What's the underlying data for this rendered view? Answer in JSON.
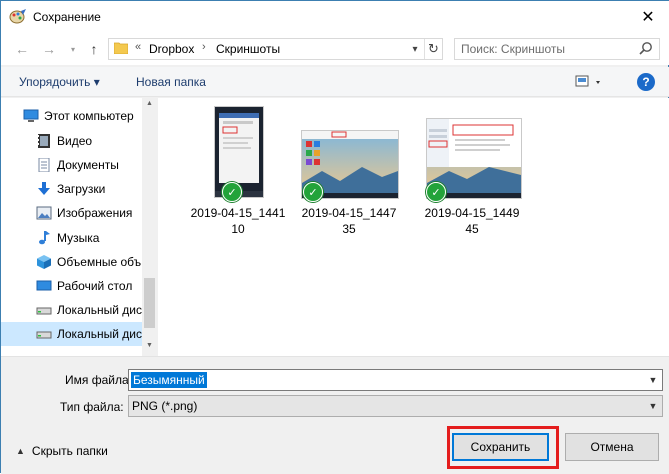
{
  "window": {
    "title": "Сохранение"
  },
  "nav": {
    "breadcrumb_sep": "«",
    "breadcrumb": [
      "Dropbox",
      "Скриншоты"
    ],
    "crumb_arrow": "›",
    "search_placeholder": "Поиск: Скриншоты"
  },
  "toolbar": {
    "organize_label": "Упорядочить ▾",
    "new_folder_label": "Новая папка",
    "help_label": "?"
  },
  "sidebar": {
    "items": [
      {
        "label": "Этот компьютер",
        "icon": "computer-icon"
      },
      {
        "label": "Видео",
        "icon": "video-icon"
      },
      {
        "label": "Документы",
        "icon": "documents-icon"
      },
      {
        "label": "Загрузки",
        "icon": "downloads-icon"
      },
      {
        "label": "Изображения",
        "icon": "pictures-icon"
      },
      {
        "label": "Музыка",
        "icon": "music-icon"
      },
      {
        "label": "Объемные объ",
        "icon": "3d-objects-icon"
      },
      {
        "label": "Рабочий стол",
        "icon": "desktop-icon"
      },
      {
        "label": "Локальный дис",
        "icon": "local-disk-icon"
      },
      {
        "label": "Локальный дис",
        "icon": "local-disk-icon",
        "selected": true
      }
    ]
  },
  "files": [
    {
      "name_line1": "2019-04-15_1441",
      "name_line2": "10"
    },
    {
      "name_line1": "2019-04-15_1447",
      "name_line2": "35"
    },
    {
      "name_line1": "2019-04-15_1449",
      "name_line2": "45"
    }
  ],
  "form": {
    "filename_label": "Имя файла:",
    "filename_value": "Безымянный",
    "filetype_label": "Тип файла:",
    "filetype_value": "PNG (*.png)"
  },
  "footer": {
    "hide_folders_label": "Скрыть папки",
    "save_label": "Сохранить",
    "cancel_label": "Отмена"
  },
  "colors": {
    "accent": "#0078d7",
    "highlight": "#e41d1d",
    "check_green": "#23a33a"
  }
}
